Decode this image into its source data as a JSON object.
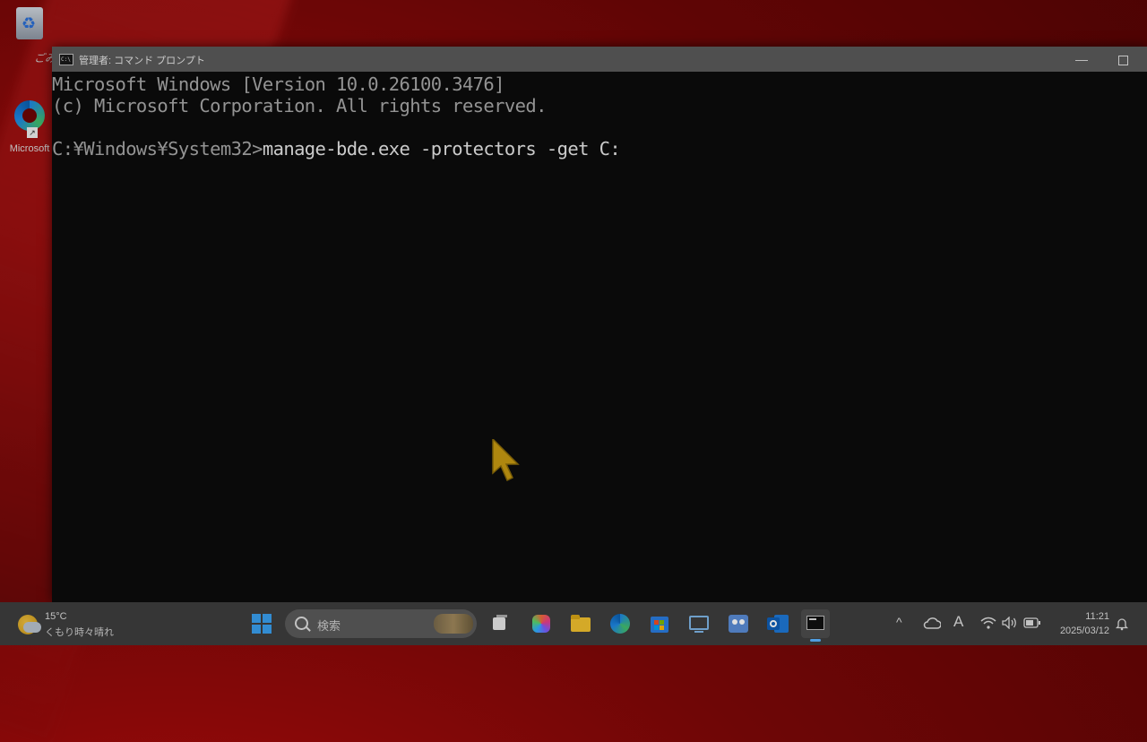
{
  "desktop": {
    "recycle_bin_caption": "ごみ",
    "edge_shortcut_label": "Microsoft"
  },
  "console": {
    "window_title": "管理者: コマンド プロンプト",
    "title_icon_text": "C:\\",
    "minimize_glyph": "—",
    "lines": [
      "Microsoft Windows [Version 10.0.26100.3476]",
      "(c) Microsoft Corporation. All rights reserved."
    ],
    "prompt": "C:¥Windows¥System32>",
    "command": "manage-bde.exe -protectors -get C:"
  },
  "taskbar": {
    "weather_temp": "15°C",
    "weather_desc": "くもり時々晴れ",
    "search_placeholder": "検索",
    "tray": {
      "chevron": "^",
      "ime": "A"
    },
    "clock_time": "11:21",
    "clock_date": "2025/03/12"
  },
  "colors": {
    "console_bg": "#0c0c0c",
    "console_text": "#a8a8a8",
    "titlebar": "#5a5a5a",
    "taskbar": "#3e3e3e",
    "cursor": "#c89a12"
  }
}
